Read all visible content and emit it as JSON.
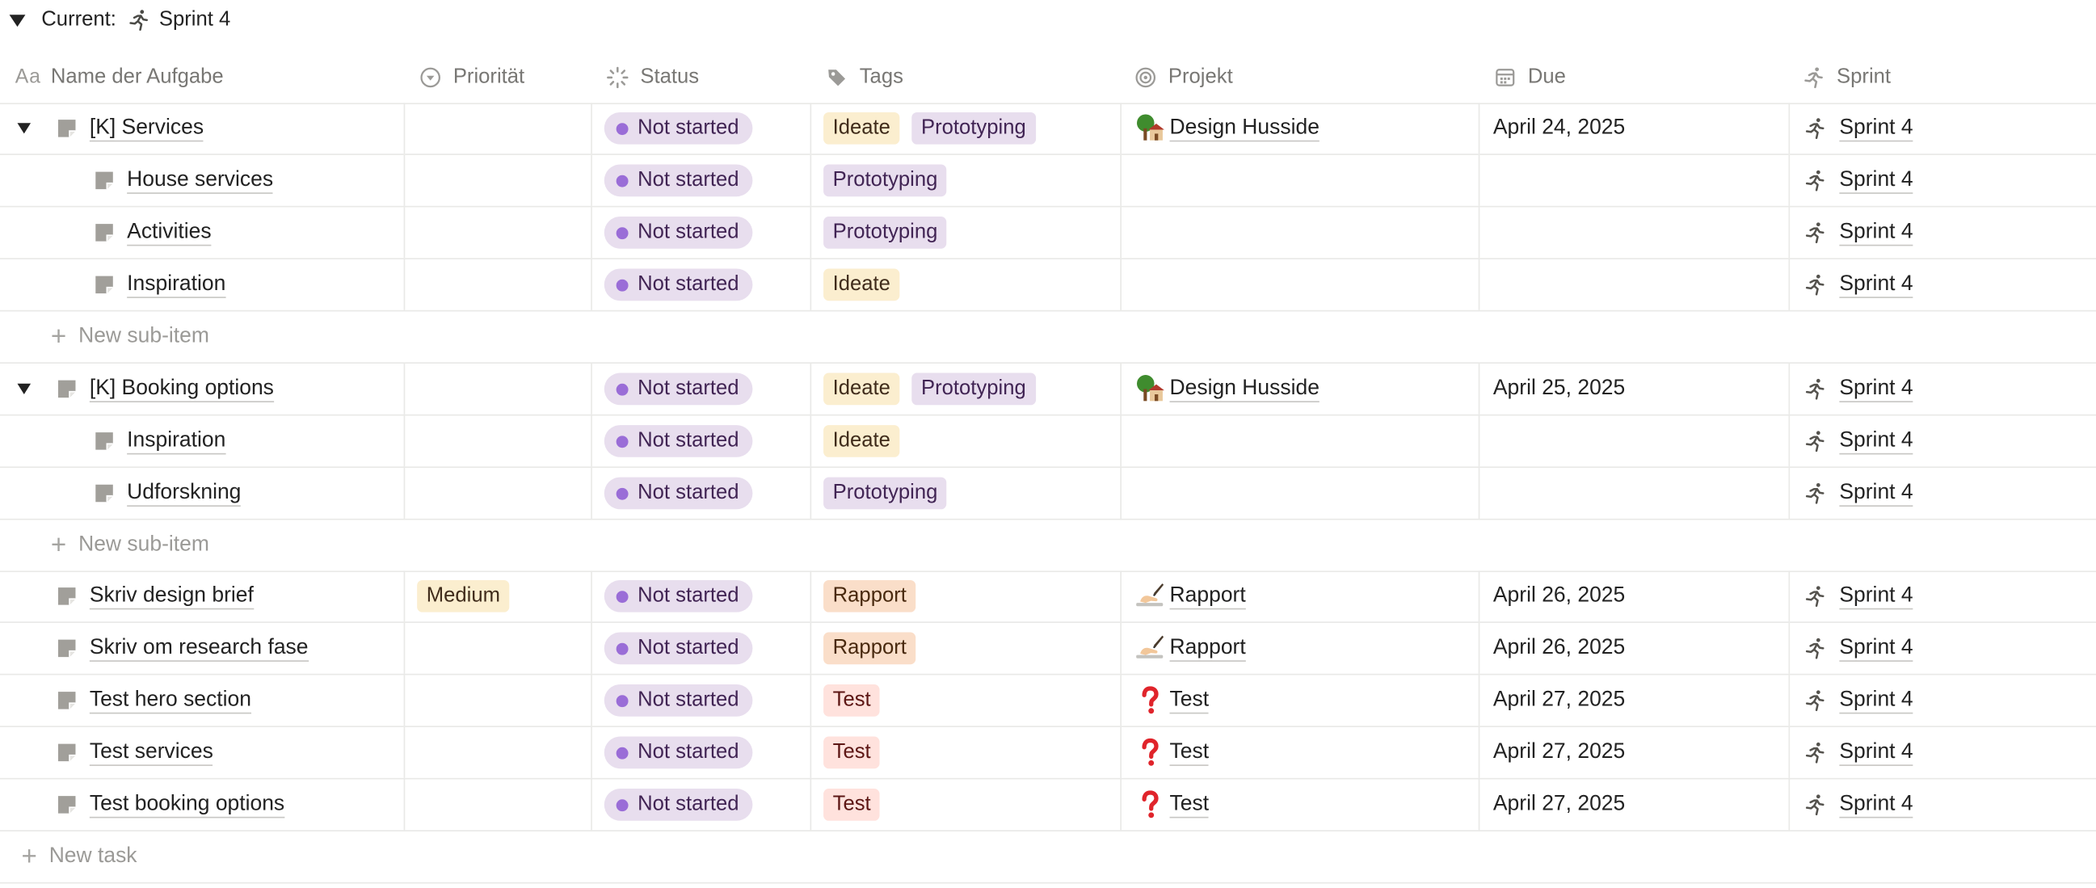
{
  "group": {
    "label": "Current:",
    "value": "Sprint 4"
  },
  "columns": {
    "name": "Name der Aufgabe",
    "name_icon": "Aa",
    "priority": "Priorität",
    "status": "Status",
    "tags": "Tags",
    "project": "Projekt",
    "due": "Due",
    "sprint": "Sprint"
  },
  "rows": {
    "r1": {
      "title": "[K] Services",
      "status": "Not started",
      "tags": [
        "Ideate",
        "Prototyping"
      ],
      "project": "Design Husside",
      "due": "April 24, 2025",
      "sprint": "Sprint 4"
    },
    "r2": {
      "title": "House services",
      "status": "Not started",
      "tags": [
        "Prototyping"
      ],
      "sprint": "Sprint 4"
    },
    "r3": {
      "title": "Activities",
      "status": "Not started",
      "tags": [
        "Prototyping"
      ],
      "sprint": "Sprint 4"
    },
    "r4": {
      "title": "Inspiration",
      "status": "Not started",
      "tags": [
        "Ideate"
      ],
      "sprint": "Sprint 4"
    },
    "r5": {
      "title": "[K] Booking options",
      "status": "Not started",
      "tags": [
        "Ideate",
        "Prototyping"
      ],
      "project": "Design Husside",
      "due": "April 25, 2025",
      "sprint": "Sprint 4"
    },
    "r6": {
      "title": "Inspiration",
      "status": "Not started",
      "tags": [
        "Ideate"
      ],
      "sprint": "Sprint 4"
    },
    "r7": {
      "title": "Udforskning",
      "status": "Not started",
      "tags": [
        "Prototyping"
      ],
      "sprint": "Sprint 4"
    },
    "r8": {
      "title": "Skriv design brief",
      "priority": "Medium",
      "status": "Not started",
      "tags": [
        "Rapport"
      ],
      "project": "Rapport",
      "due": "April 26, 2025",
      "sprint": "Sprint 4"
    },
    "r9": {
      "title": "Skriv om research fase",
      "status": "Not started",
      "tags": [
        "Rapport"
      ],
      "project": "Rapport",
      "due": "April 26, 2025",
      "sprint": "Sprint 4"
    },
    "r10": {
      "title": "Test hero section",
      "status": "Not started",
      "tags": [
        "Test"
      ],
      "project": "Test",
      "due": "April 27, 2025",
      "sprint": "Sprint 4"
    },
    "r11": {
      "title": "Test services",
      "status": "Not started",
      "tags": [
        "Test"
      ],
      "project": "Test",
      "due": "April 27, 2025",
      "sprint": "Sprint 4"
    },
    "r12": {
      "title": "Test booking options",
      "status": "Not started",
      "tags": [
        "Test"
      ],
      "project": "Test",
      "due": "April 27, 2025",
      "sprint": "Sprint 4"
    }
  },
  "actions": {
    "new_sub_item": "New sub-item",
    "new_task": "New task"
  },
  "project_icons": {
    "Design Husside": "house-with-tree-icon",
    "Rapport": "writing-hand-icon",
    "Test": "red-question-mark-icon"
  },
  "colors": {
    "status_pill": "#e8deee",
    "status_dot": "#9a6dd7",
    "tag_ideate": "#fbeecf",
    "tag_prototyping": "#e8deee",
    "tag_rapport": "#fadec9",
    "tag_test": "#ffe2dd"
  }
}
